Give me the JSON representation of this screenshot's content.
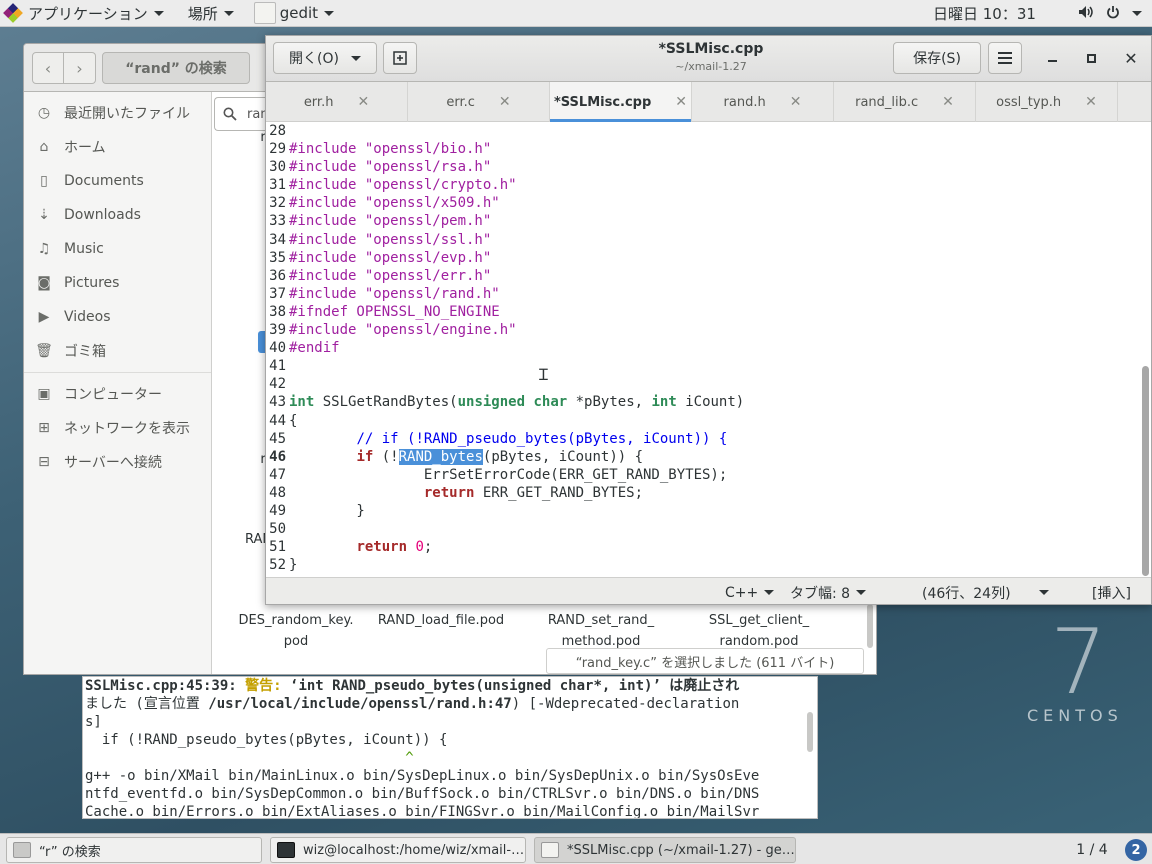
{
  "topbar": {
    "apps_label": "アプリケーション",
    "places_label": "場所",
    "app_label": "gedit",
    "clock": "日曜日 10：31"
  },
  "branding": {
    "seven": "7",
    "centos": "CENTOS"
  },
  "file_manager": {
    "title": "“rand” の検索",
    "search_value": "ran",
    "sidebar": [
      {
        "label": "最近開いたファイル",
        "icon": "clock-icon"
      },
      {
        "label": "ホーム",
        "icon": "home-icon"
      },
      {
        "label": "Documents",
        "icon": "document-icon"
      },
      {
        "label": "Downloads",
        "icon": "download-icon"
      },
      {
        "label": "Music",
        "icon": "music-icon"
      },
      {
        "label": "Pictures",
        "icon": "camera-icon"
      },
      {
        "label": "Videos",
        "icon": "video-icon"
      },
      {
        "label": "ゴミ箱",
        "icon": "trash-icon"
      },
      {
        "label": "コンピューター",
        "icon": "computer-icon"
      },
      {
        "label": "ネットワークを表示",
        "icon": "network-icon"
      },
      {
        "label": "サーバーへ接続",
        "icon": "server-icon"
      }
    ],
    "files": [
      {
        "line1": "DES_random_key.",
        "line2": "pod"
      },
      {
        "line1": "RAND_load_file.pod",
        "line2": ""
      },
      {
        "line1": "RAND_set_rand_",
        "line2": "method.pod"
      },
      {
        "line1": "SSL_get_client_",
        "line2": "random.pod"
      }
    ],
    "partial_labels": [
      "ra",
      "ra",
      "RAN"
    ],
    "status": "“rand_key.c” を選択しました (611 バイト)"
  },
  "terminal": {
    "lines": [
      {
        "parts": [
          {
            "t": "SSLMisc.cpp:45:39: ",
            "c": "b"
          },
          {
            "t": "警告: ",
            "c": "warn"
          },
          {
            "t": "‘int RAND_pseudo_bytes(unsigned char*, int)’ は廃止され",
            "c": "b"
          }
        ]
      },
      {
        "parts": [
          {
            "t": "ました (宣言位置 ",
            "c": ""
          },
          {
            "t": "/usr/local/include/openssl/rand.h:47",
            "c": "b"
          },
          {
            "t": ") [-Wdeprecated-declaration",
            "c": ""
          }
        ]
      },
      {
        "parts": [
          {
            "t": "s]",
            "c": ""
          }
        ]
      },
      {
        "parts": [
          {
            "t": "  if (!RAND_pseudo_bytes(pBytes, iCount)) {",
            "c": ""
          }
        ]
      },
      {
        "parts": [
          {
            "t": "                                      ^",
            "c": "caretline"
          }
        ]
      },
      {
        "parts": [
          {
            "t": "g++ -o bin/XMail bin/MainLinux.o bin/SysDepLinux.o bin/SysDepUnix.o bin/SysOsEve",
            "c": ""
          }
        ]
      },
      {
        "parts": [
          {
            "t": "ntfd_eventfd.o bin/SysDepCommon.o bin/BuffSock.o bin/CTRLSvr.o bin/DNS.o bin/DNS",
            "c": ""
          }
        ]
      },
      {
        "parts": [
          {
            "t": "Cache.o bin/Errors.o bin/ExtAliases.o bin/FINGSvr.o bin/MailConfig.o bin/MailSvr",
            "c": ""
          }
        ]
      }
    ]
  },
  "gedit": {
    "open_label": "開く(O)",
    "title": "*SSLMisc.cpp",
    "subtitle": "~/xmail-1.27",
    "save_label": "保存(S)",
    "tabs": [
      {
        "label": "err.h",
        "active": false
      },
      {
        "label": "err.c",
        "active": false
      },
      {
        "label": "*SSLMisc.cpp",
        "active": true
      },
      {
        "label": "rand.h",
        "active": false
      },
      {
        "label": "rand_lib.c",
        "active": false
      },
      {
        "label": "ossl_typ.h",
        "active": false
      }
    ],
    "code": [
      {
        "n": "28",
        "s": []
      },
      {
        "n": "29",
        "s": [
          {
            "t": "#include ",
            "c": "pp"
          },
          {
            "t": "\"openssl/bio.h\"",
            "c": "str"
          }
        ]
      },
      {
        "n": "30",
        "s": [
          {
            "t": "#include ",
            "c": "pp"
          },
          {
            "t": "\"openssl/rsa.h\"",
            "c": "str"
          }
        ]
      },
      {
        "n": "31",
        "s": [
          {
            "t": "#include ",
            "c": "pp"
          },
          {
            "t": "\"openssl/crypto.h\"",
            "c": "str"
          }
        ]
      },
      {
        "n": "32",
        "s": [
          {
            "t": "#include ",
            "c": "pp"
          },
          {
            "t": "\"openssl/x509.h\"",
            "c": "str"
          }
        ]
      },
      {
        "n": "33",
        "s": [
          {
            "t": "#include ",
            "c": "pp"
          },
          {
            "t": "\"openssl/pem.h\"",
            "c": "str"
          }
        ]
      },
      {
        "n": "34",
        "s": [
          {
            "t": "#include ",
            "c": "pp"
          },
          {
            "t": "\"openssl/ssl.h\"",
            "c": "str"
          }
        ]
      },
      {
        "n": "35",
        "s": [
          {
            "t": "#include ",
            "c": "pp"
          },
          {
            "t": "\"openssl/evp.h\"",
            "c": "str"
          }
        ]
      },
      {
        "n": "36",
        "s": [
          {
            "t": "#include ",
            "c": "pp"
          },
          {
            "t": "\"openssl/err.h\"",
            "c": "str"
          }
        ]
      },
      {
        "n": "37",
        "s": [
          {
            "t": "#include ",
            "c": "pp"
          },
          {
            "t": "\"openssl/rand.h\"",
            "c": "str"
          }
        ]
      },
      {
        "n": "38",
        "s": [
          {
            "t": "#ifndef OPENSSL_NO_ENGINE",
            "c": "pp"
          }
        ]
      },
      {
        "n": "39",
        "s": [
          {
            "t": "#include ",
            "c": "pp"
          },
          {
            "t": "\"openssl/engine.h\"",
            "c": "str"
          }
        ]
      },
      {
        "n": "40",
        "s": [
          {
            "t": "#endif",
            "c": "pp"
          }
        ]
      },
      {
        "n": "41",
        "s": []
      },
      {
        "n": "42",
        "s": []
      },
      {
        "n": "43",
        "s": [
          {
            "t": "int",
            "c": "ty"
          },
          {
            "t": " SSLGetRandBytes(",
            "c": ""
          },
          {
            "t": "unsigned",
            "c": "ty"
          },
          {
            "t": " ",
            "c": ""
          },
          {
            "t": "char",
            "c": "ty"
          },
          {
            "t": " *pBytes, ",
            "c": ""
          },
          {
            "t": "int",
            "c": "ty"
          },
          {
            "t": " iCount)",
            "c": ""
          }
        ]
      },
      {
        "n": "44",
        "s": [
          {
            "t": "{",
            "c": ""
          }
        ]
      },
      {
        "n": "45",
        "s": [
          {
            "t": "        ",
            "c": ""
          },
          {
            "t": "// if (!RAND_pseudo_bytes(pBytes, iCount)) {",
            "c": "cm"
          }
        ]
      },
      {
        "n": "46",
        "cur": true,
        "s": [
          {
            "t": "        ",
            "c": ""
          },
          {
            "t": "if",
            "c": "kw"
          },
          {
            "t": " (!",
            "c": ""
          },
          {
            "t": "RAND_bytes",
            "c": "sel"
          },
          {
            "t": "(pBytes, iCount)) {",
            "c": ""
          }
        ]
      },
      {
        "n": "47",
        "s": [
          {
            "t": "                ErrSetErrorCode(ERR_GET_RAND_BYTES);",
            "c": ""
          }
        ]
      },
      {
        "n": "48",
        "s": [
          {
            "t": "                ",
            "c": ""
          },
          {
            "t": "return",
            "c": "kw"
          },
          {
            "t": " ERR_GET_RAND_BYTES;",
            "c": ""
          }
        ]
      },
      {
        "n": "49",
        "s": [
          {
            "t": "        }",
            "c": ""
          }
        ]
      },
      {
        "n": "50",
        "s": []
      },
      {
        "n": "51",
        "s": [
          {
            "t": "        ",
            "c": ""
          },
          {
            "t": "return",
            "c": "kw"
          },
          {
            "t": " ",
            "c": ""
          },
          {
            "t": "0",
            "c": "num"
          },
          {
            "t": ";",
            "c": ""
          }
        ]
      },
      {
        "n": "52",
        "s": [
          {
            "t": "}",
            "c": ""
          }
        ]
      }
    ],
    "status": {
      "language": "C++",
      "tab_width": "タブ幅: 8",
      "position": "(46行、24列)",
      "mode": "[挿入]"
    }
  },
  "taskbar": {
    "tasks": [
      {
        "label": "“r” の検索",
        "active": false
      },
      {
        "label": "wiz@localhost:/home/wiz/xmail-…",
        "active": false
      },
      {
        "label": "*SSLMisc.cpp (~/xmail-1.27) - ge…",
        "active": true
      }
    ],
    "pager": "1 / 4",
    "notifications": "2"
  }
}
